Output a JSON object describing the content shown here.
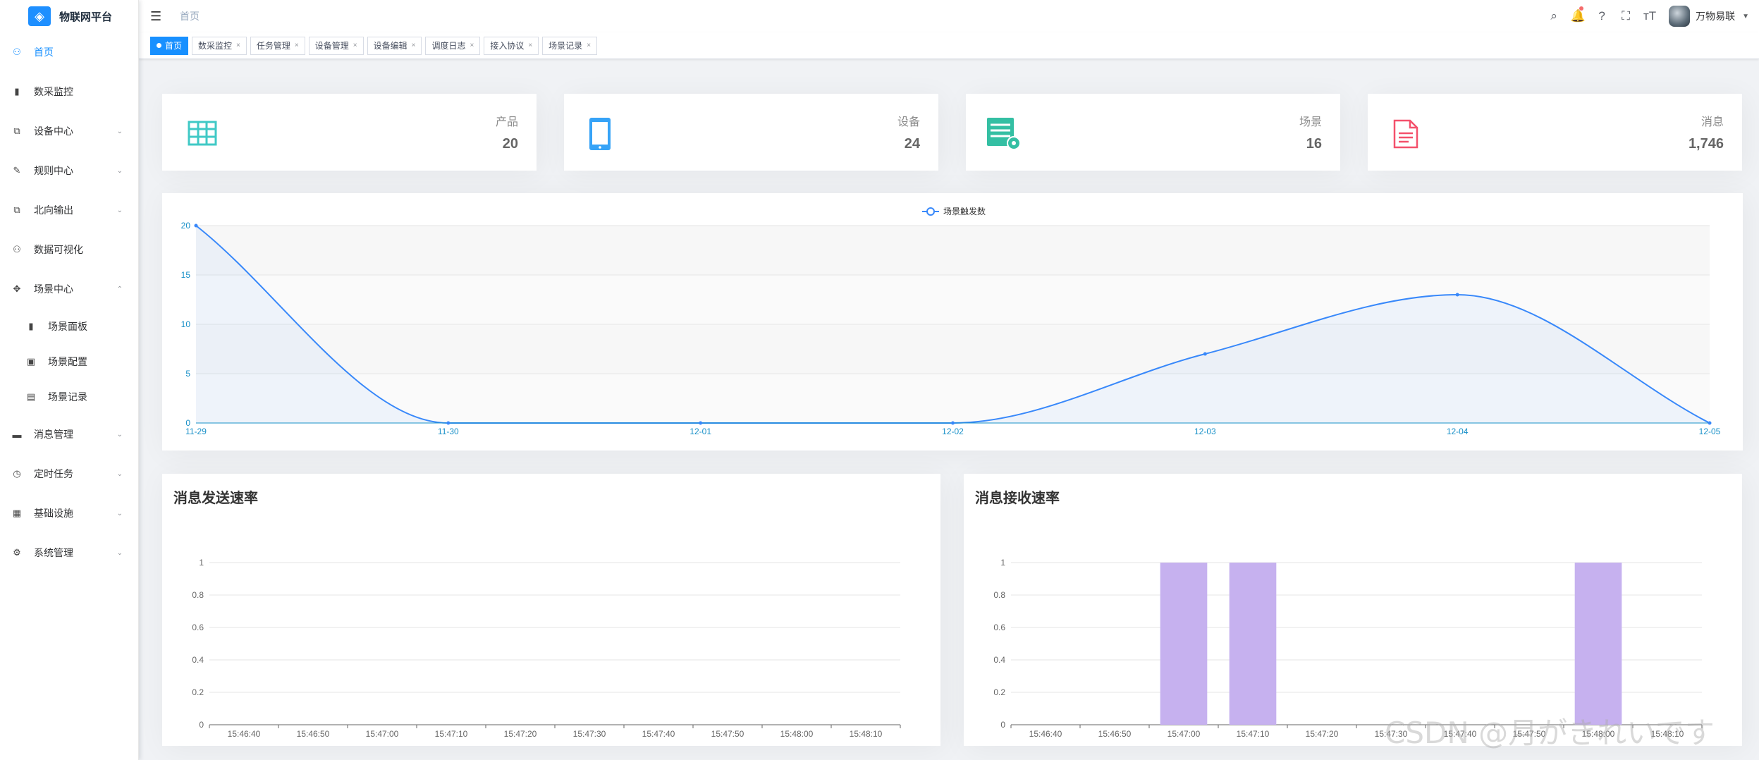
{
  "app": {
    "title": "物联网平台"
  },
  "sidebar": {
    "items": [
      {
        "label": "首页",
        "icon": "dashboard-icon",
        "glyph": "⚇",
        "active": true
      },
      {
        "label": "数采监控",
        "icon": "bar-chart-icon",
        "glyph": "▮"
      },
      {
        "label": "设备中心",
        "icon": "device-tree-icon",
        "glyph": "⧉",
        "arrow": "⌄"
      },
      {
        "label": "规则中心",
        "icon": "ruler-icon",
        "glyph": "✎",
        "arrow": "⌄"
      },
      {
        "label": "北向输出",
        "icon": "export-icon",
        "glyph": "⧉",
        "arrow": "⌄"
      },
      {
        "label": "数据可视化",
        "icon": "visualization-icon",
        "glyph": "⚇"
      },
      {
        "label": "场景中心",
        "icon": "scene-center-icon",
        "glyph": "✥",
        "arrow": "⌃"
      },
      {
        "label": "消息管理",
        "icon": "message-icon",
        "glyph": "▬",
        "arrow": "⌄"
      },
      {
        "label": "定时任务",
        "icon": "clock-icon",
        "glyph": "◷",
        "arrow": "⌄"
      },
      {
        "label": "基础设施",
        "icon": "infrastructure-icon",
        "glyph": "▦",
        "arrow": "⌄"
      },
      {
        "label": "系统管理",
        "icon": "settings-icon",
        "glyph": "⚙",
        "arrow": "⌄"
      }
    ],
    "scene_sub_items": [
      {
        "label": "场景面板",
        "icon": "bar-chart-icon",
        "glyph": "▮"
      },
      {
        "label": "场景配置",
        "icon": "config-icon",
        "glyph": "▣"
      },
      {
        "label": "场景记录",
        "icon": "record-icon",
        "glyph": "▤"
      }
    ]
  },
  "header": {
    "breadcrumb": "首页",
    "username": "万物易联",
    "icons": [
      {
        "name": "search-icon",
        "glyph": "⌕"
      },
      {
        "name": "bell-icon",
        "glyph": "🔔",
        "dot": true
      },
      {
        "name": "help-icon",
        "glyph": "?"
      },
      {
        "name": "fullscreen-icon",
        "glyph": "⛶"
      },
      {
        "name": "font-size-icon",
        "glyph": "тT"
      }
    ]
  },
  "tags": [
    {
      "label": "首页",
      "active": true
    },
    {
      "label": "数采监控"
    },
    {
      "label": "任务管理"
    },
    {
      "label": "设备管理"
    },
    {
      "label": "设备编辑"
    },
    {
      "label": "调度日志"
    },
    {
      "label": "接入协议"
    },
    {
      "label": "场景记录"
    }
  ],
  "stats": [
    {
      "label": "产品",
      "value": "20",
      "icon": "table-icon",
      "color": "#40c9c6"
    },
    {
      "label": "设备",
      "value": "24",
      "icon": "phone-icon",
      "color": "#36a3f7"
    },
    {
      "label": "场景",
      "value": "16",
      "icon": "server-gear-icon",
      "color": "#34bfa3"
    },
    {
      "label": "消息",
      "value": "1,746",
      "icon": "document-icon",
      "color": "#f4516c"
    }
  ],
  "charts": {
    "send_title": "消息发送速率",
    "receive_title": "消息接收速率",
    "watermark": "CSDN @月がきれいです"
  },
  "chart_data": [
    {
      "type": "area",
      "title": "",
      "series": [
        {
          "name": "场景触发数",
          "values": [
            20,
            0,
            0,
            0,
            7,
            13,
            0
          ]
        }
      ],
      "x": [
        "11-29",
        "11-30",
        "12-01",
        "12-02",
        "12-03",
        "12-04",
        "12-05"
      ],
      "ylim": [
        0,
        20
      ],
      "yticks": [
        0,
        5,
        10,
        15,
        20
      ],
      "color": "#3888fa",
      "legend": "top-center",
      "grid": true
    },
    {
      "type": "bar",
      "title": "消息发送速率",
      "categories": [
        "15:46:40",
        "15:46:50",
        "15:47:00",
        "15:47:10",
        "15:47:20",
        "15:47:30",
        "15:47:40",
        "15:47:50",
        "15:48:00",
        "15:48:10"
      ],
      "values": [
        0,
        0,
        0,
        0,
        0,
        0,
        0,
        0,
        0,
        0
      ],
      "ylim": [
        0,
        1
      ],
      "yticks": [
        "0",
        "0.2",
        "0.4",
        "0.6",
        "0.8",
        "1"
      ],
      "grid": true
    },
    {
      "type": "bar",
      "title": "消息接收速率",
      "categories": [
        "15:46:40",
        "15:46:50",
        "15:47:00",
        "15:47:10",
        "15:47:20",
        "15:47:30",
        "15:47:40",
        "15:47:50",
        "15:48:00",
        "15:48:10"
      ],
      "values": [
        0,
        0,
        1,
        1,
        0,
        0,
        0,
        0,
        1,
        0
      ],
      "ylim": [
        0,
        1
      ],
      "yticks": [
        "0",
        "0.2",
        "0.4",
        "0.6",
        "0.8",
        "1"
      ],
      "color": "#c6b1ef",
      "grid": true
    }
  ]
}
